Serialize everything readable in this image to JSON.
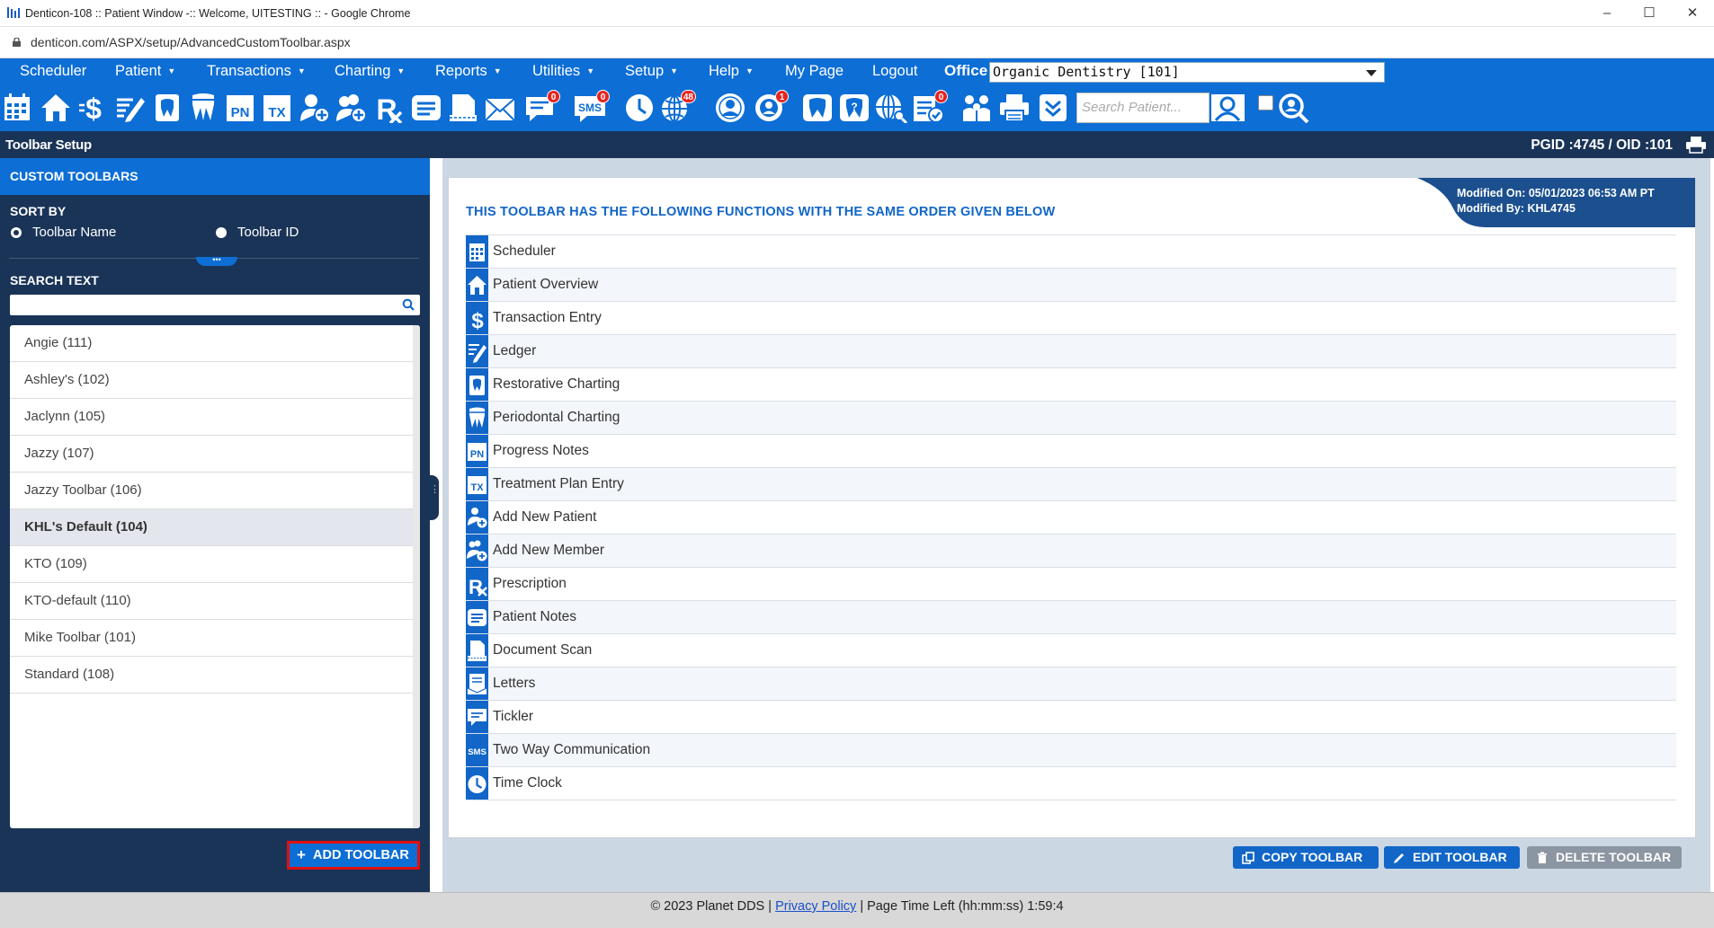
{
  "window": {
    "title": "Denticon-108 :: Patient Window -:: Welcome, UITESTING :: - Google Chrome",
    "controls": [
      "–",
      "☐",
      "✕"
    ],
    "url": "denticon.com/ASPX/setup/AdvancedCustomToolbar.aspx"
  },
  "nav": {
    "items": [
      {
        "label": "Scheduler",
        "caret": false
      },
      {
        "label": "Patient",
        "caret": true
      },
      {
        "label": "Transactions",
        "caret": true
      },
      {
        "label": "Charting",
        "caret": true
      },
      {
        "label": "Reports",
        "caret": true
      },
      {
        "label": "Utilities",
        "caret": true
      },
      {
        "label": "Setup",
        "caret": true
      },
      {
        "label": "Help",
        "caret": true
      },
      {
        "label": "My Page",
        "caret": false
      },
      {
        "label": "Logout",
        "caret": false
      }
    ],
    "office_label": "Office",
    "office_value": "Organic Dentistry [101]"
  },
  "icon_toolbar": {
    "badges": {
      "messages": "0",
      "sms": "0",
      "web": "48",
      "alerts": "1",
      "forms": "0"
    },
    "search_placeholder": "Search Patient..."
  },
  "page_header": {
    "title": "Toolbar Setup",
    "ids": "PGID :4745  /  OID :101"
  },
  "left": {
    "header": "CUSTOM TOOLBARS",
    "sort_by": "SORT BY",
    "sort_options": [
      {
        "label": "Toolbar Name",
        "checked": true
      },
      {
        "label": "Toolbar ID",
        "checked": false
      }
    ],
    "collapse_label": "•••",
    "search_label": "SEARCH TEXT",
    "search_value": "",
    "toolbars": [
      {
        "label": "Angie (111)",
        "selected": false
      },
      {
        "label": "Ashley's (102)",
        "selected": false
      },
      {
        "label": "Jaclynn (105)",
        "selected": false
      },
      {
        "label": "Jazzy (107)",
        "selected": false
      },
      {
        "label": "Jazzy Toolbar (106)",
        "selected": false
      },
      {
        "label": "KHL's Default (104)",
        "selected": true
      },
      {
        "label": "KTO (109)",
        "selected": false
      },
      {
        "label": "KTO-default (110)",
        "selected": false
      },
      {
        "label": "Mike Toolbar (101)",
        "selected": false
      },
      {
        "label": "Standard (108)",
        "selected": false
      }
    ],
    "add_button": "ADD TOOLBAR"
  },
  "main": {
    "modified_on": "Modified On: 05/01/2023 06:53 AM PT",
    "modified_by": "Modified By: KHL4745",
    "functions_title": "THIS TOOLBAR HAS THE FOLLOWING FUNCTIONS WITH THE SAME ORDER GIVEN BELOW",
    "functions": [
      {
        "label": "Scheduler",
        "icon": "calendar-icon"
      },
      {
        "label": "Patient Overview",
        "icon": "home-icon"
      },
      {
        "label": "Transaction Entry",
        "icon": "dollar-icon"
      },
      {
        "label": "Ledger",
        "icon": "ledger-icon"
      },
      {
        "label": "Restorative Charting",
        "icon": "tooth-chart-icon"
      },
      {
        "label": "Periodontal Charting",
        "icon": "perio-chart-icon"
      },
      {
        "label": "Progress Notes",
        "icon": "pn-icon"
      },
      {
        "label": "Treatment Plan Entry",
        "icon": "tx-icon"
      },
      {
        "label": "Add New Patient",
        "icon": "add-patient-icon"
      },
      {
        "label": "Add New Member",
        "icon": "add-member-icon"
      },
      {
        "label": "Prescription",
        "icon": "rx-icon"
      },
      {
        "label": "Patient Notes",
        "icon": "notes-icon"
      },
      {
        "label": "Document Scan",
        "icon": "scan-icon"
      },
      {
        "label": "Letters",
        "icon": "letter-icon"
      },
      {
        "label": "Tickler",
        "icon": "tickler-icon"
      },
      {
        "label": "Two Way Communication",
        "icon": "sms-icon"
      },
      {
        "label": "Time Clock",
        "icon": "clock-icon"
      }
    ],
    "sms_glyph": "SMS",
    "pn_glyph": "PN",
    "tx_glyph": "TX",
    "buttons": {
      "copy": "COPY TOOLBAR",
      "edit": "EDIT TOOLBAR",
      "delete": "DELETE TOOLBAR"
    }
  },
  "status": {
    "copyright": "© 2023 Planet DDS",
    "sep": "|",
    "privacy": "Privacy Policy",
    "time_left": "| Page Time Left (hh:mm:ss) 1:59:4"
  },
  "colors": {
    "nav_blue": "#0d6ed5",
    "dark_navy": "#1a3458",
    "highlight_red": "#e01010",
    "delete_gray": "#8c96a3"
  }
}
